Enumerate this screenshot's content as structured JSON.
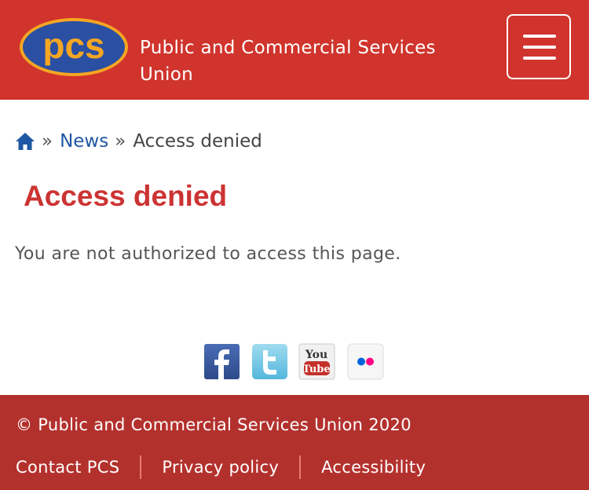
{
  "header": {
    "logo_text": "pcs",
    "org_name": "Public and Commercial Services Union",
    "menu_icon": "hamburger-icon"
  },
  "breadcrumb": {
    "home_icon": "home-icon",
    "separator": "»",
    "items": [
      {
        "label": "News"
      },
      {
        "label": "Access denied"
      }
    ]
  },
  "main": {
    "title": "Access denied",
    "message": "You are not authorized to access this page."
  },
  "social": [
    {
      "name": "facebook",
      "icon": "facebook-icon",
      "color": "#3b5998"
    },
    {
      "name": "twitter",
      "icon": "twitter-icon",
      "color": "#55acee"
    },
    {
      "name": "youtube",
      "icon": "youtube-icon",
      "color": "#c4302b"
    },
    {
      "name": "flickr",
      "icon": "flickr-icon",
      "color": "#0063dc"
    }
  ],
  "footer": {
    "copyright": "© Public and Commercial Services Union 2020",
    "links": [
      {
        "label": "Contact PCS"
      },
      {
        "label": "Privacy policy"
      },
      {
        "label": "Accessibility"
      }
    ]
  },
  "colors": {
    "header_bg": "#d0342c",
    "footer_bg": "#b3312d",
    "title": "#cc3333",
    "link": "#1f57a4",
    "logo_blue": "#2b4fa2",
    "logo_orange": "#f5a623"
  }
}
